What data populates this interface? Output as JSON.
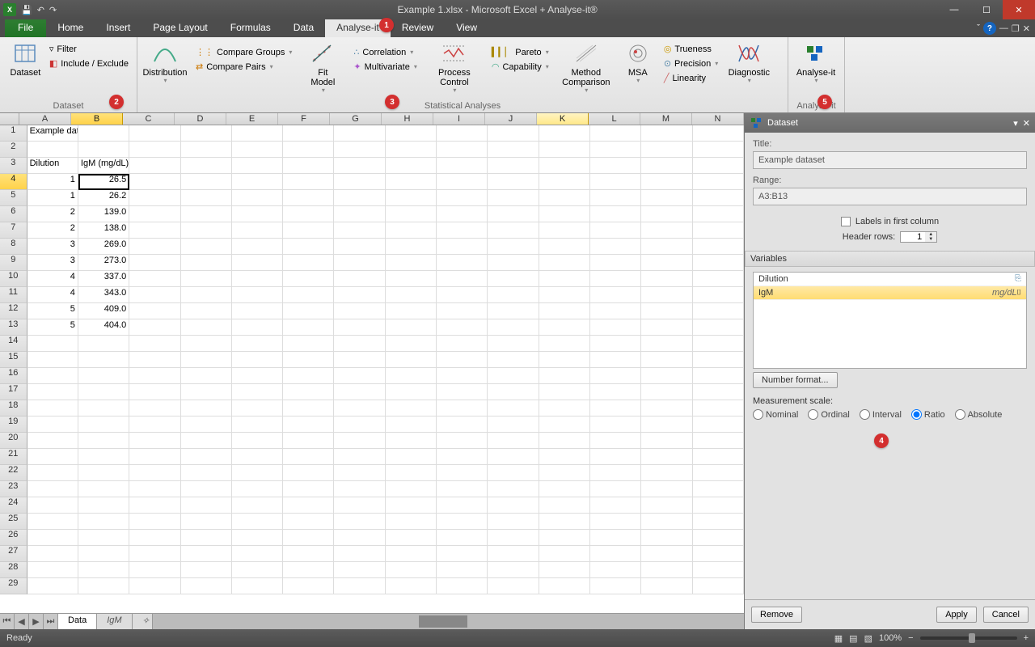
{
  "window_title": "Example 1.xlsx - Microsoft Excel + Analyse-it®",
  "file_tab": "File",
  "tabs": [
    "Home",
    "Insert",
    "Page Layout",
    "Formulas",
    "Data",
    "Analyse-it",
    "Review",
    "View"
  ],
  "active_tab": "Analyse-it",
  "ribbon": {
    "dataset_group": "Dataset",
    "dataset_btn": "Dataset",
    "filter": "Filter",
    "include_exclude": "Include / Exclude",
    "stats_group": "Statistical Analyses",
    "distribution": "Distribution",
    "compare_groups": "Compare Groups",
    "compare_pairs": "Compare Pairs",
    "fit_model": "Fit\nModel",
    "correlation": "Correlation",
    "multivariate": "Multivariate",
    "process_control": "Process Control",
    "pareto": "Pareto",
    "capability": "Capability",
    "method_comparison": "Method\nComparison",
    "msa": "MSA",
    "trueness": "Trueness",
    "precision": "Precision",
    "linearity": "Linearity",
    "diagnostic": "Diagnostic",
    "analyse_it_group": "Analyse-it",
    "analyse_it": "Analyse-it"
  },
  "columns": [
    "A",
    "B",
    "C",
    "D",
    "E",
    "F",
    "G",
    "H",
    "I",
    "J",
    "K",
    "L",
    "M",
    "N"
  ],
  "selected_col": "B",
  "highlight_col": "K",
  "selected_row": 4,
  "grid": {
    "r1": {
      "A": "Example dataset"
    },
    "r3": {
      "A": "Dilution",
      "B": "IgM (mg/dL)"
    },
    "r4": {
      "A": "1",
      "B": "26.5"
    },
    "r5": {
      "A": "1",
      "B": "26.2"
    },
    "r6": {
      "A": "2",
      "B": "139.0"
    },
    "r7": {
      "A": "2",
      "B": "138.0"
    },
    "r8": {
      "A": "3",
      "B": "269.0"
    },
    "r9": {
      "A": "3",
      "B": "273.0"
    },
    "r10": {
      "A": "4",
      "B": "337.0"
    },
    "r11": {
      "A": "4",
      "B": "343.0"
    },
    "r12": {
      "A": "5",
      "B": "409.0"
    },
    "r13": {
      "A": "5",
      "B": "404.0"
    }
  },
  "sheets": {
    "active": "Data",
    "other": "IgM"
  },
  "panel": {
    "title": "Dataset",
    "title_label": "Title:",
    "title_value": "Example dataset",
    "range_label": "Range:",
    "range_value": "A3:B13",
    "labels_first_col": "Labels in first column",
    "header_rows_label": "Header rows:",
    "header_rows_value": "1",
    "variables_label": "Variables",
    "vars": [
      {
        "name": "Dilution",
        "unit": ""
      },
      {
        "name": "IgM",
        "unit": "mg/dL",
        "selected": true
      }
    ],
    "number_format": "Number format...",
    "scale_label": "Measurement scale:",
    "scales": [
      "Nominal",
      "Ordinal",
      "Interval",
      "Ratio",
      "Absolute"
    ],
    "scale_selected": "Ratio",
    "remove": "Remove",
    "apply": "Apply",
    "cancel": "Cancel"
  },
  "status": {
    "ready": "Ready",
    "zoom": "100%"
  },
  "callouts": {
    "c1": "1",
    "c2": "2",
    "c3": "3",
    "c4": "4",
    "c5": "5"
  }
}
